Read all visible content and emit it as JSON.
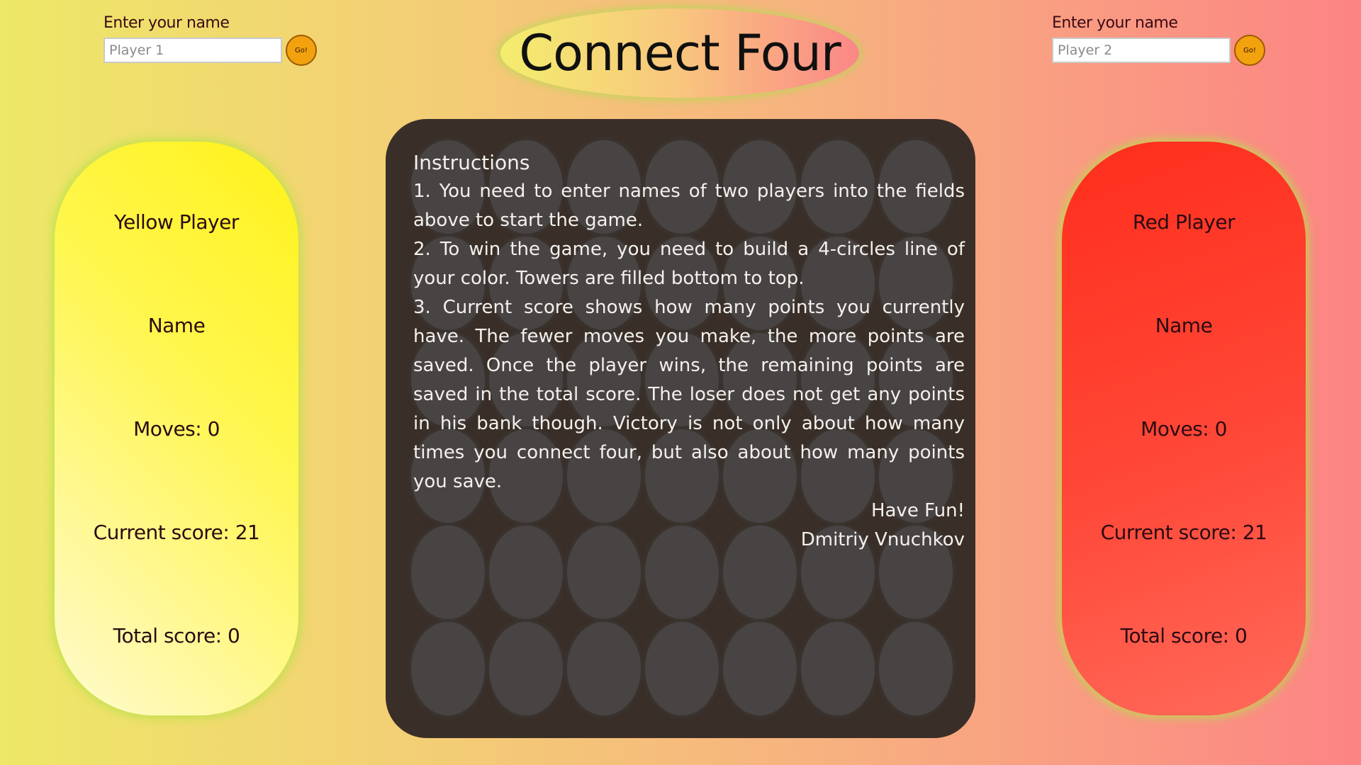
{
  "title": "Connect Four",
  "name_entry_left": {
    "label": "Enter your name",
    "placeholder": "Player 1",
    "go_label": "Go!"
  },
  "name_entry_right": {
    "label": "Enter your name",
    "placeholder": "Player 2",
    "go_label": "Go!"
  },
  "yellow_player": {
    "heading": "Yellow Player",
    "name": "Name",
    "moves": "Moves: 0",
    "current_score": "Current score: 21",
    "total_score": "Total score: 0",
    "color": "#fff21a"
  },
  "red_player": {
    "heading": "Red Player",
    "name": "Name",
    "moves": "Moves: 0",
    "current_score": "Current score: 21",
    "total_score": "Total score: 0",
    "color": "#ff2e1c"
  },
  "board": {
    "columns": 7,
    "rows": 6,
    "background": "#3a2f28",
    "cell_color": "#494444"
  },
  "instructions": {
    "heading": "Instructions",
    "items": [
      "1. You need to enter names of two players into the fields above to start the game.",
      "2. To win the game, you need to build a 4-circles line of your color. Towers are filled bottom to top.",
      "3. Current score shows how many points you currently have. The fewer moves you make, the more points are saved. Once the player wins, the remaining points are saved in the total score. The loser does not get any points in his bank though. Victory is not only about how many times you connect four, but also about how many points you save."
    ],
    "closing": "Have Fun!",
    "author": "Dmitriy Vnuchkov"
  }
}
